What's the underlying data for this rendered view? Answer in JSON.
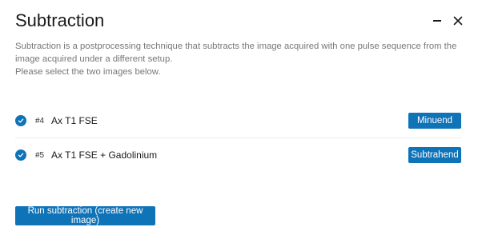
{
  "dialog": {
    "title": "Subtraction",
    "description_line1": "Subtraction is a postprocessing technique that subtracts the image acquired with one pulse sequence from the image acquired under a different setup.",
    "description_line2": "Please select the two images below."
  },
  "window_controls": {
    "minimize_icon": "minimize-icon",
    "close_icon": "close-icon"
  },
  "series": [
    {
      "number": "#4",
      "name": "Ax T1 FSE",
      "selected": true,
      "role_label": "Minuend"
    },
    {
      "number": "#5",
      "name": "Ax T1 FSE + Gadolinium",
      "selected": true,
      "role_label": "Subtrahend"
    }
  ],
  "actions": {
    "run_label": "Run subtraction (create new image)"
  },
  "colors": {
    "accent": "#0f73b8",
    "description_text": "#777777",
    "title_text": "#1a1a1a"
  }
}
